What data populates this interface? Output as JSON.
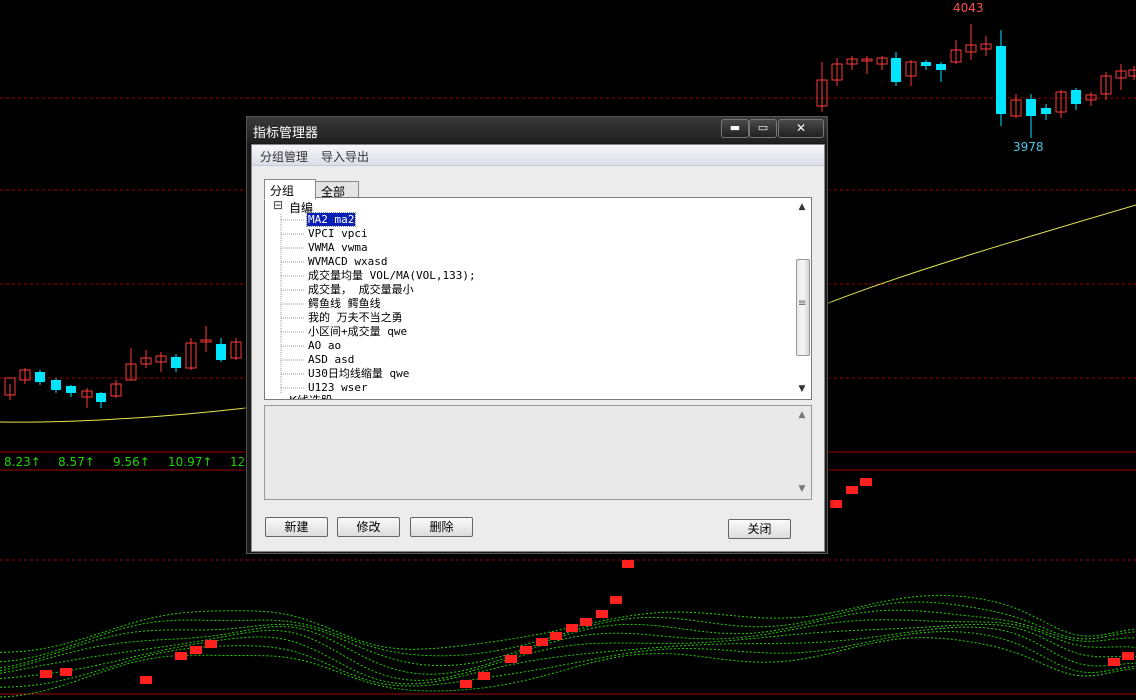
{
  "chart": {
    "price_high": "4043",
    "price_low": "3978",
    "indicator_values": [
      "8.23↑",
      "8.57↑",
      "9.56↑",
      "10.97↑",
      "12"
    ],
    "colors": {
      "up": "#ff3a3a",
      "down": "#00e5ff",
      "ma": "#e6e650",
      "grid": "#a00000",
      "green": "#22d400",
      "text_red": "#ff5050",
      "text_cyan": "#4ec7e8"
    }
  },
  "dialog": {
    "title": "指标管理器",
    "window_buttons": {
      "minimize": "▬",
      "maximize": "▭",
      "close": "✕"
    },
    "menu": [
      "分组管理",
      "导入导出"
    ],
    "tabs": [
      "分组",
      "全部"
    ],
    "tree": {
      "root_expander": "⊟",
      "root": "自编",
      "items": [
        "MA2 ma2",
        "VPCI vpci",
        "VWMA vwma",
        "WVMACD wxasd",
        "成交量均量 VOL/MA(VOL,133);",
        "成交量， 成交量最小",
        "鳄鱼线 鳄鱼线",
        "我的 万夫不当之勇",
        "小区间+成交量 qwe",
        "AO ao",
        "ASD asd",
        "U30日均线缩量 qwe",
        "U123 wser"
      ],
      "next_group_partial": "K线选股",
      "selected_index": 0
    },
    "scroll_up": "▲",
    "scroll_down": "▼",
    "scroll_grip": "≡",
    "buttons": {
      "new": "新建",
      "modify": "修改",
      "delete": "删除",
      "close": "关闭"
    }
  }
}
